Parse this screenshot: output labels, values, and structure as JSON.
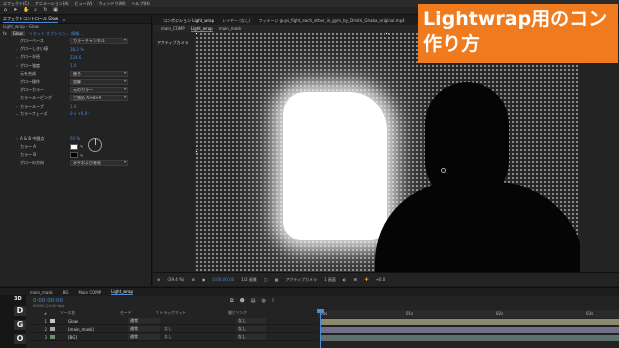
{
  "menu": [
    "エフェクト(C)",
    "アニメーション(A)",
    "ビュー(V)",
    "ウィンドウ(W)",
    "ヘルプ(H)"
  ],
  "effect_controls": {
    "tab_label": "エフェクトコントロール Glow",
    "tab_alt": "=",
    "sub_label": "Light_wrap・Glow",
    "fx_name": "Glow",
    "fx_links": "リセット  オプション...  情報...",
    "props": [
      {
        "name": "グローベース",
        "value": "カラーチャンネル",
        "kind": "select"
      },
      {
        "name": "グローしきい値",
        "value": "38.2 %",
        "kind": "value"
      },
      {
        "name": "グロー半径",
        "value": "234.6",
        "kind": "value"
      },
      {
        "name": "グロー強度",
        "value": "1.0",
        "kind": "value"
      },
      {
        "name": "元を合成",
        "value": "後ろ",
        "kind": "select"
      },
      {
        "name": "グロー操作",
        "value": "加算",
        "kind": "select"
      },
      {
        "name": "グローカラー",
        "value": "元のカラー",
        "kind": "select"
      },
      {
        "name": "カラールーピング",
        "value": "三角形 A>B>A",
        "kind": "select"
      },
      {
        "name": "カラーループ",
        "value": "1.0",
        "kind": "value"
      },
      {
        "name": "カラーフェーズ",
        "value": "0 x +0.0°",
        "kind": "value"
      },
      {
        "name": "A & B 中間点",
        "value": "50 %",
        "kind": "value"
      },
      {
        "name": "カラー A",
        "value": "",
        "kind": "color-white"
      },
      {
        "name": "カラー B",
        "value": "",
        "kind": "color-black"
      },
      {
        "name": "グローの方向",
        "value": "水平および垂直",
        "kind": "select"
      }
    ]
  },
  "composition": {
    "tabs": [
      "コンポジション Light_wrap",
      "レイヤー (なし)",
      "フッテージ guys_fight_each_other_in_gym_by_Dmitri_Ghaba_original.mp4"
    ],
    "sub_tabs": [
      "main_COMP",
      "Light_wrap",
      "main_mask"
    ],
    "active_camera": "アクティブカメラ",
    "bottom": {
      "zoom": "(39.4 %)",
      "timecode": "0:00:00:00",
      "resolution": "1/2 画質",
      "camera": "アクティブカメラ",
      "views": "1 画面",
      "exposure": "+0.0"
    }
  },
  "overlay": {
    "line1": "Lightwrap用のコン",
    "line2": "作り方",
    "color": "#f07a1e"
  },
  "timeline": {
    "tabs": [
      "main_mask",
      "BG",
      "Main COMP",
      "Light_wrap"
    ],
    "timecode": "0:00:00:00",
    "fps": "00000 (24.00 fps)",
    "columns": [
      "#",
      "ソース名",
      "モード",
      "T トラックマット",
      "親とリンク"
    ],
    "ruler": [
      "00s",
      "01s",
      "02s",
      "03s"
    ],
    "layers": [
      {
        "num": "1",
        "name": "Glow",
        "mode": "通常",
        "track": "",
        "parent": "なし",
        "color": "#c9c9c9",
        "bar": "#8c8a6e"
      },
      {
        "num": "2",
        "name": "[main_mask]",
        "mode": "通常",
        "track": "なし",
        "parent": "なし",
        "color": "#a9a9a9",
        "bar": "#6f6f8a"
      },
      {
        "num": "3",
        "name": "[BG]",
        "mode": "通常",
        "track": "なし",
        "parent": "なし",
        "color": "#6b8f6b",
        "bar": "#5e6f6e"
      }
    ]
  },
  "panel_letters": [
    "D",
    "G",
    "O"
  ],
  "panel_label_3d": "3D"
}
